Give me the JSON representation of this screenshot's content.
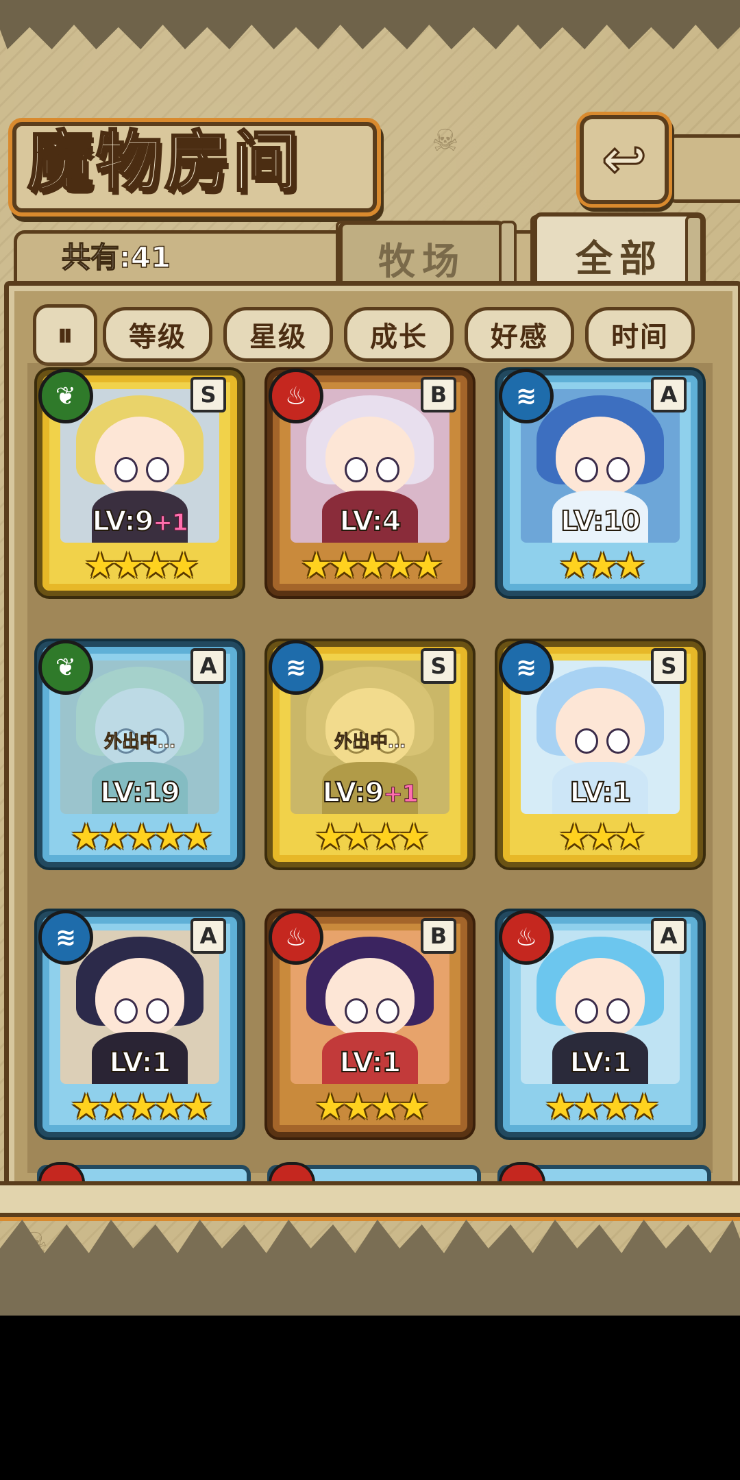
{
  "title": "魔物房间",
  "count_label": "共有:41",
  "tabs": {
    "ranch": "牧场",
    "all": "全部"
  },
  "sort_toggle_glyph": "⏸",
  "sort_buttons": [
    "等级",
    "星级",
    "成长",
    "好感",
    "时间"
  ],
  "back_glyph": "↩",
  "cards": [
    {
      "element": "nature",
      "rank": "S",
      "frame": "gold",
      "level": "LV:9",
      "plus": "+1",
      "stars": 4,
      "away": ""
    },
    {
      "element": "fire",
      "rank": "B",
      "frame": "bronze",
      "level": "LV:4",
      "plus": "",
      "stars": 5,
      "away": ""
    },
    {
      "element": "water",
      "rank": "A",
      "frame": "blue",
      "level": "LV:10",
      "plus": "",
      "stars": 3,
      "away": ""
    },
    {
      "element": "nature",
      "rank": "A",
      "frame": "blue",
      "level": "LV:19",
      "plus": "",
      "stars": 5,
      "away": "外出中…"
    },
    {
      "element": "water",
      "rank": "S",
      "frame": "gold",
      "level": "LV:9",
      "plus": "+1",
      "stars": 4,
      "away": "外出中…"
    },
    {
      "element": "water",
      "rank": "S",
      "frame": "gold",
      "level": "LV:1",
      "plus": "",
      "stars": 3,
      "away": ""
    },
    {
      "element": "water",
      "rank": "A",
      "frame": "blue",
      "level": "LV:1",
      "plus": "",
      "stars": 5,
      "away": ""
    },
    {
      "element": "fire",
      "rank": "B",
      "frame": "bronze",
      "level": "LV:1",
      "plus": "",
      "stars": 4,
      "away": ""
    },
    {
      "element": "fire",
      "rank": "A",
      "frame": "blue",
      "level": "LV:1",
      "plus": "",
      "stars": 4,
      "away": ""
    }
  ],
  "element_icons": {
    "nature": "leaf-icon",
    "fire": "flame-icon",
    "water": "water-wave-icon"
  },
  "colors": {
    "gold_frame": "#f1d24a",
    "bronze_frame": "#c98a3c",
    "blue_frame": "#8fd0ec",
    "star": "#ffd21f",
    "plus_level": "#ff6fae"
  }
}
